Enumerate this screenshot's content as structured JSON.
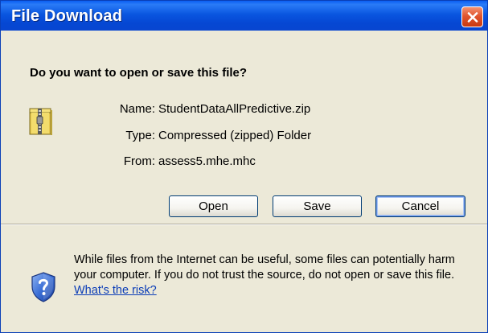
{
  "window": {
    "title": "File Download",
    "close_icon": "close-icon"
  },
  "dialog": {
    "question": "Do you want to open or save this file?",
    "file_icon": "zip-folder-icon",
    "fields": [
      {
        "label": "Name:",
        "value": "StudentDataAllPredictive.zip"
      },
      {
        "label": "Type:",
        "value": "Compressed (zipped) Folder"
      },
      {
        "label": "From:",
        "value": "assess5.mhe.mhc"
      }
    ],
    "buttons": {
      "open": "Open",
      "save": "Save",
      "cancel": "Cancel"
    },
    "warning": {
      "icon": "shield-question-icon",
      "text": "While files from the Internet can be useful, some files can potentially harm your computer. If you do not trust the source, do not open or save this file.",
      "link": "What's the risk?"
    }
  },
  "colors": {
    "titlebar": "#0a56e0",
    "dialog_bg": "#ece9d8",
    "close_button": "#e1562f",
    "link": "#0a3cb7",
    "button_border": "#003c74"
  }
}
